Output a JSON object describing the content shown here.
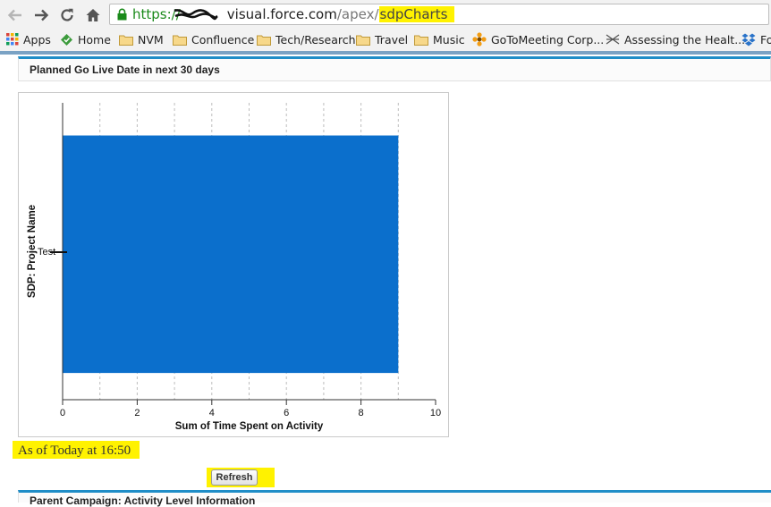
{
  "browser": {
    "url_scheme": "https://",
    "url_host": "visual.force.com",
    "url_path": "/apex/",
    "url_page": "sdpCharts",
    "bookmarks": [
      {
        "label": "Apps",
        "icon": "apps-grid-icon"
      },
      {
        "label": "Home",
        "icon": "home-bookmark-icon"
      },
      {
        "label": "NVM",
        "icon": "folder-icon"
      },
      {
        "label": "Confluence",
        "icon": "folder-icon"
      },
      {
        "label": "Tech/Research",
        "icon": "folder-icon"
      },
      {
        "label": "Travel",
        "icon": "folder-icon"
      },
      {
        "label": "Music",
        "icon": "folder-icon"
      },
      {
        "label": "GoToMeeting Corp...",
        "icon": "gotomeeting-icon"
      },
      {
        "label": "Assessing the Healt...",
        "icon": "site-icon"
      },
      {
        "label": "Fo",
        "icon": "dropbox-icon"
      }
    ]
  },
  "panel": {
    "title": "Planned Go Live Date in next 30 days"
  },
  "chart_data": {
    "type": "bar",
    "orientation": "horizontal",
    "categories": [
      "Test"
    ],
    "values": [
      9
    ],
    "xlabel": "Sum of Time Spent on Activity",
    "ylabel": "SDP: Project Name",
    "xlim": [
      0,
      10
    ],
    "xticks": [
      0,
      2,
      4,
      6,
      8,
      10
    ],
    "bar_color": "#0b6fcc",
    "grid": "vertical dashed"
  },
  "status": {
    "as_of": "As of Today at 16:50"
  },
  "actions": {
    "refresh_label": "Refresh"
  },
  "next_panel": {
    "title": "Parent Campaign: Activity Level Information"
  }
}
